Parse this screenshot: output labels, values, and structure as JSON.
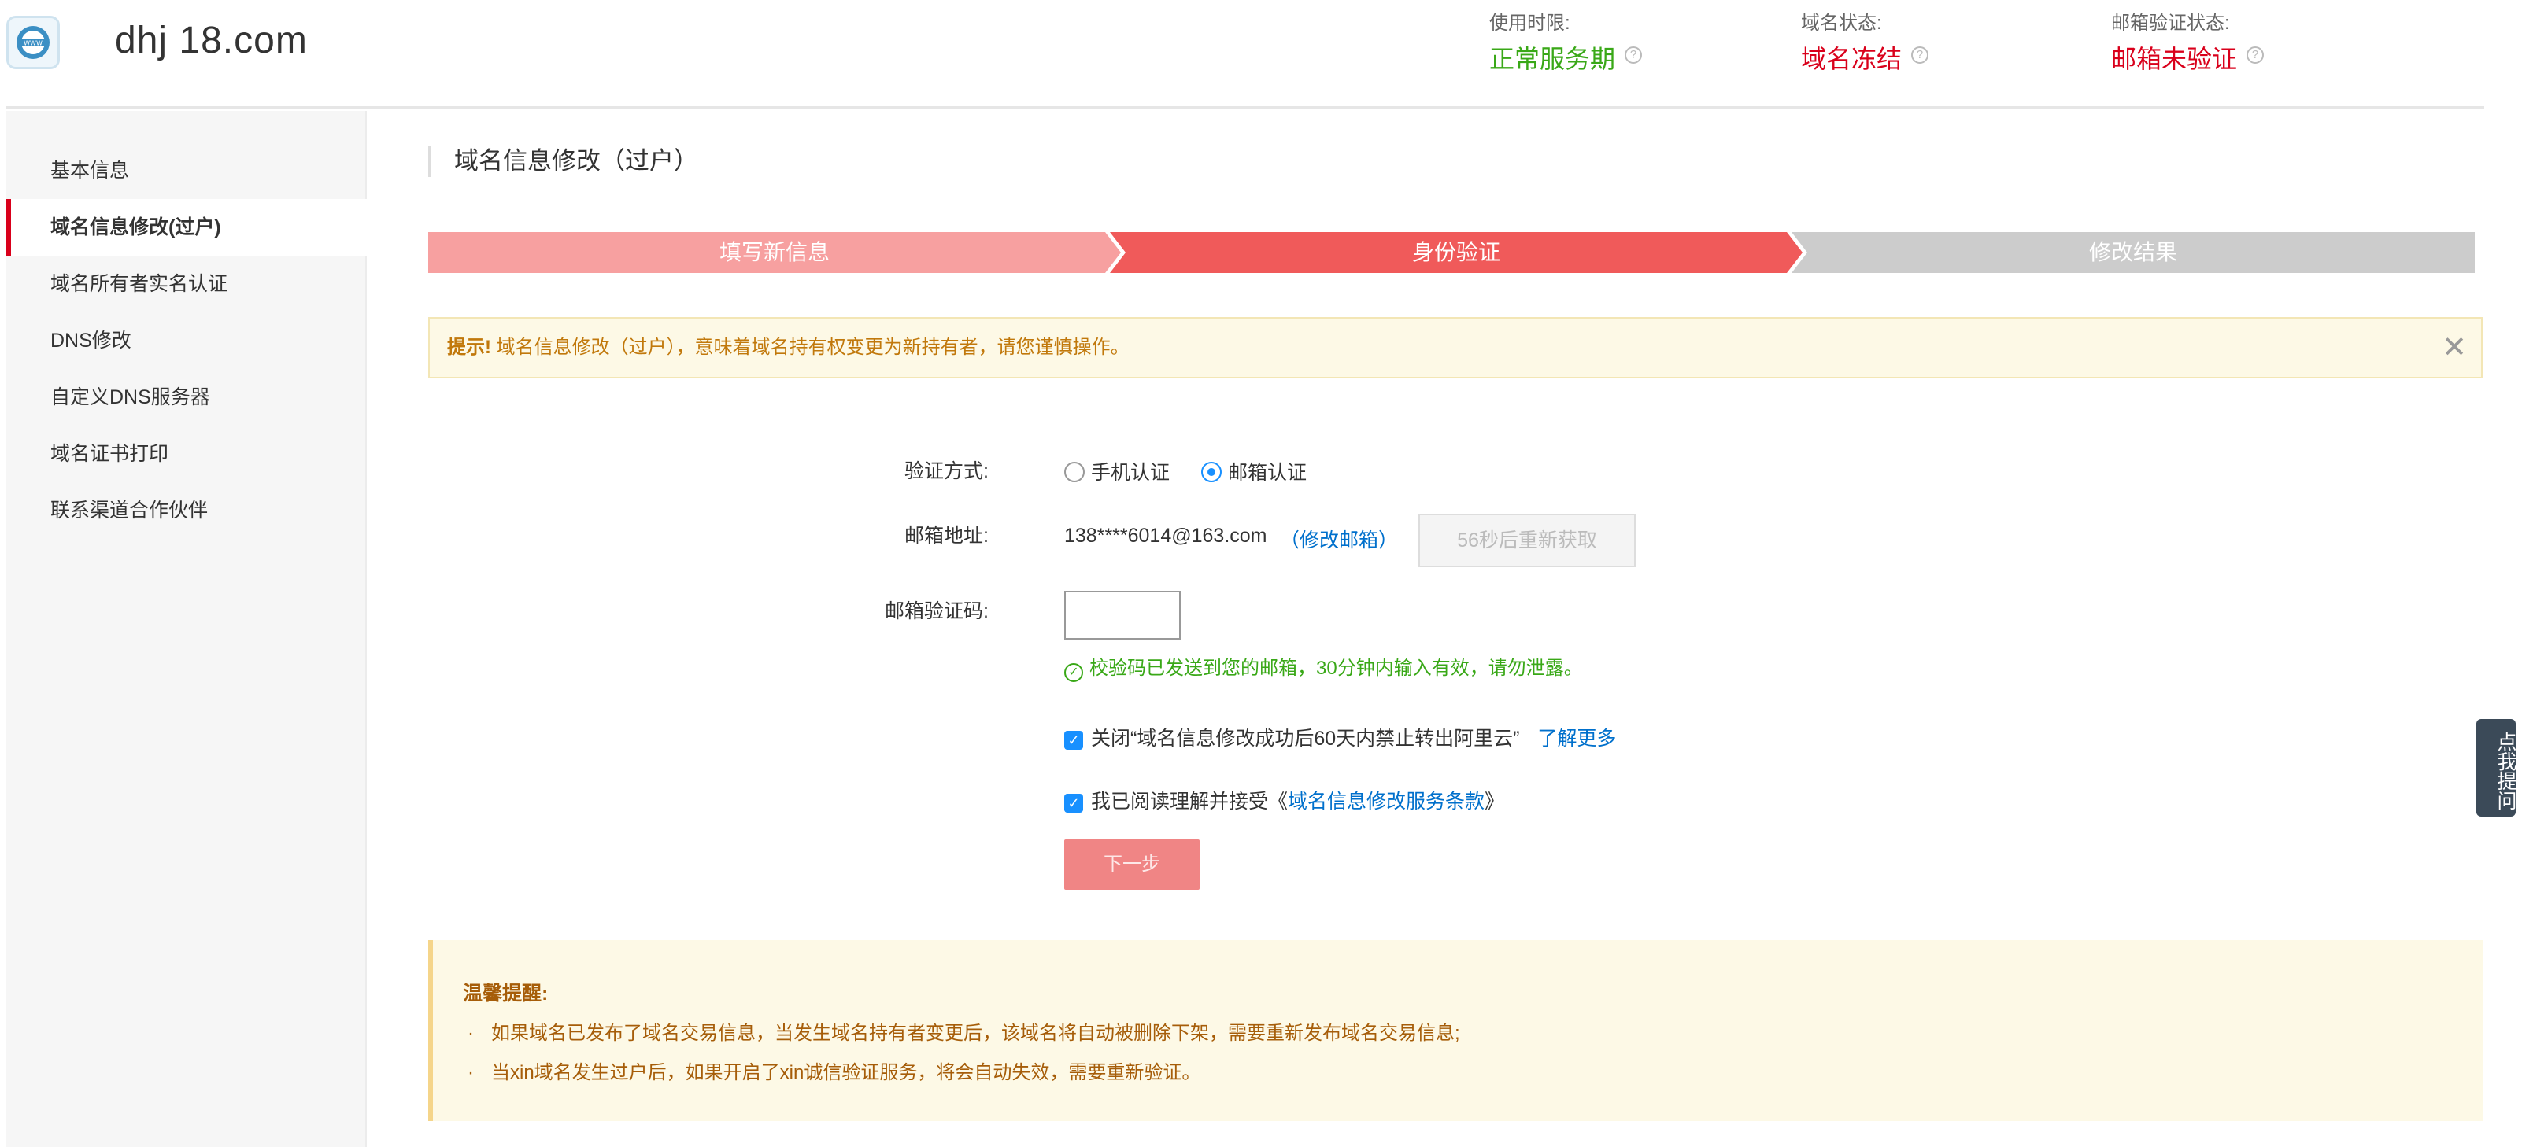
{
  "header": {
    "domain": "dhj     18.com",
    "stats": [
      {
        "label": "使用时限:",
        "value": "正常服务期",
        "color": "#39a817"
      },
      {
        "label": "域名状态:",
        "value": "域名冻结",
        "color": "#d9001b"
      },
      {
        "label": "邮箱验证状态:",
        "value": "邮箱未验证",
        "color": "#d9001b"
      }
    ],
    "help_glyph": "?"
  },
  "sidebar": {
    "items": [
      {
        "label": "基本信息",
        "active": false
      },
      {
        "label": "域名信息修改(过户)",
        "active": true
      },
      {
        "label": "域名所有者实名认证",
        "active": false
      },
      {
        "label": "DNS修改",
        "active": false
      },
      {
        "label": "自定义DNS服务器",
        "active": false
      },
      {
        "label": "域名证书打印",
        "active": false
      },
      {
        "label": "联系渠道合作伙伴",
        "active": false
      }
    ]
  },
  "main": {
    "title": "域名信息修改（过户）",
    "steps": [
      {
        "label": "填写新信息",
        "state": "done"
      },
      {
        "label": "身份验证",
        "state": "current"
      },
      {
        "label": "修改结果",
        "state": "todo"
      }
    ],
    "tip": {
      "prefix": "提示!",
      "text": "域名信息修改（过户），意味着域名持有权变更为新持有者，请您谨慎操作。",
      "close": "✕"
    },
    "form": {
      "method_label": "验证方式:",
      "method_phone": "手机认证",
      "method_email": "邮箱认证",
      "email_label": "邮箱地址:",
      "email_value": "138****6014@163.com",
      "email_change": "（修改邮箱）",
      "resend_label": "56秒后重新获取",
      "code_label": "邮箱验证码:",
      "code_value": "",
      "sent_msg": "校验码已发送到您的邮箱，30分钟内输入有效，请勿泄露。",
      "check1_text": "关闭“域名信息修改成功后60天内禁止转出阿里云”",
      "check1_link": "了解更多",
      "check2_text": "我已阅读理解并接受《",
      "check2_link": "域名信息修改服务条款",
      "check2_end": "》",
      "next_label": "下一步"
    },
    "notice": {
      "title": "温馨提醒:",
      "items": [
        "如果域名已发布了域名交易信息，当发生域名持有者变更后，该域名将自动被删除下架，需要重新发布域名交易信息;",
        "当xin域名发生过户后，如果开启了xin诚信验证服务，将会自动失效，需要重新验证。"
      ],
      "bullet": "·"
    }
  },
  "float_help": "点我提问",
  "colors": {
    "accent_red": "#d9001b",
    "step_done": "#f7a0a0",
    "step_current": "#f05a5a",
    "step_todo": "#cccccc",
    "link_blue": "#0070cc",
    "success_green": "#39a817"
  }
}
